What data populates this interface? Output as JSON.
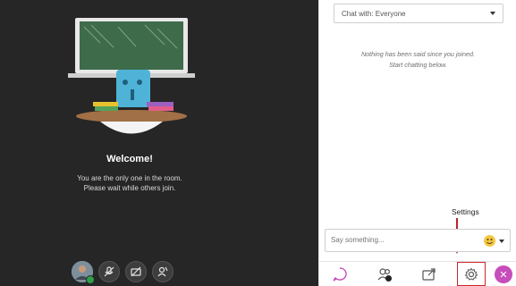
{
  "stage": {
    "welcome_title": "Welcome!",
    "welcome_line1": "You are the only one in the room.",
    "welcome_line2": "Please wait while others join."
  },
  "chat": {
    "select_value": "Chat with: Everyone",
    "empty_line1": "Nothing has been said since you joined.",
    "empty_line2": "Start chatting below.",
    "compose_placeholder": "Say something..."
  },
  "annotation": {
    "label": "Settings"
  },
  "icons": {
    "media": [
      "avatar",
      "mic-off-icon",
      "camera-off-icon",
      "hand-raise-icon"
    ],
    "bottom_tabs": [
      "chat-icon",
      "attendees-icon",
      "share-icon",
      "settings-icon",
      "close-icon"
    ]
  },
  "colors": {
    "stage_bg": "#262626",
    "accent_purple": "#c64dbb",
    "highlight_red": "#c9262c",
    "status_green": "#2e9e47"
  }
}
